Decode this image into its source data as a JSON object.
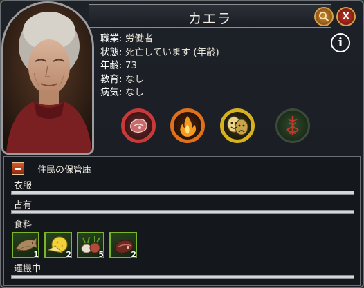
{
  "window": {
    "title": "カエラ",
    "zoom_icon": "magnifier-icon",
    "close_label": "X",
    "info_label": "i"
  },
  "stats": [
    {
      "label": "職業:",
      "value": "労働者"
    },
    {
      "label": "状態:",
      "value": "死亡しています (年齢)"
    },
    {
      "label": "年齢:",
      "value": "73"
    },
    {
      "label": "教育:",
      "value": "なし"
    },
    {
      "label": "病気:",
      "value": "なし"
    }
  ],
  "status_icons": [
    {
      "name": "food-meat-icon",
      "ring_color": "#c83a3a"
    },
    {
      "name": "fire-icon",
      "ring_color": "#e0701a"
    },
    {
      "name": "theater-masks-icon",
      "ring_color": "#d8b21c"
    },
    {
      "name": "medical-caduceus-icon",
      "ring_color": "#2e6b2a"
    }
  ],
  "storage": {
    "title": "住民の保管庫",
    "sections": {
      "clothing": "衣服",
      "owned": "占有",
      "food": "食料",
      "transport": "運搬中"
    },
    "food_items": [
      {
        "name": "fish-icon",
        "count": "1"
      },
      {
        "name": "cheese-icon",
        "count": "2"
      },
      {
        "name": "vegetables-icon",
        "count": "5"
      },
      {
        "name": "ham-icon",
        "count": "2"
      }
    ]
  }
}
